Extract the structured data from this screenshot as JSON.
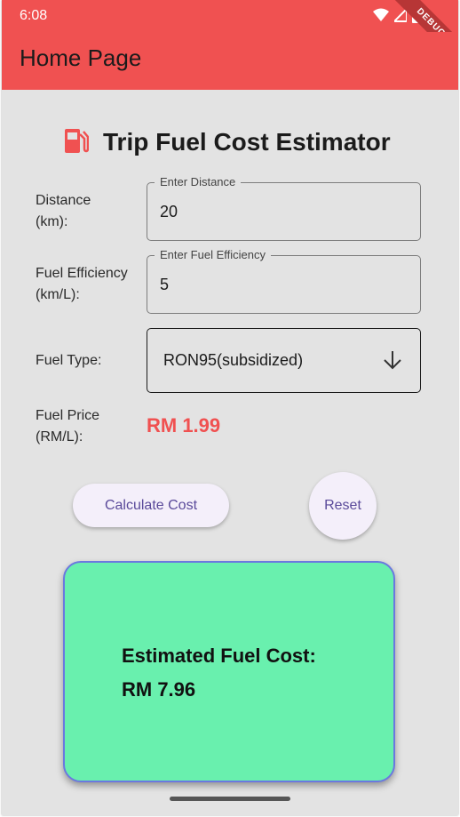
{
  "status_bar": {
    "time": "6:08",
    "debug_badge": "DEBUG",
    "icons": [
      "wifi-icon",
      "signal-icon",
      "battery-icon"
    ]
  },
  "app_bar": {
    "title": "Home Page"
  },
  "header": {
    "icon": "fuel-pump-icon",
    "title": "Trip Fuel Cost Estimator"
  },
  "form": {
    "distance": {
      "label_line1": "Distance",
      "label_line2": "(km):",
      "legend": "Enter Distance",
      "value": "20"
    },
    "efficiency": {
      "label_line1": "Fuel Efficiency",
      "label_line2": "(km/L):",
      "legend": "Enter Fuel Efficiency",
      "value": "5"
    },
    "fuel_type": {
      "label": "Fuel Type:",
      "selected": "RON95(subsidized)"
    },
    "fuel_price": {
      "label_line1": "Fuel Price",
      "label_line2": "(RM/L):",
      "value": "RM 1.99"
    }
  },
  "buttons": {
    "calculate": "Calculate Cost",
    "reset": "Reset"
  },
  "result": {
    "label": "Estimated Fuel Cost:",
    "value": "RM 7.96"
  },
  "colors": {
    "app_bar": "#f05151",
    "background": "#e3e3e3",
    "accent_red": "#f05151",
    "result_card": "#69f0ae",
    "result_border": "#6b78e0",
    "button_bg": "#f4effa",
    "button_text": "#5a4a9a"
  }
}
